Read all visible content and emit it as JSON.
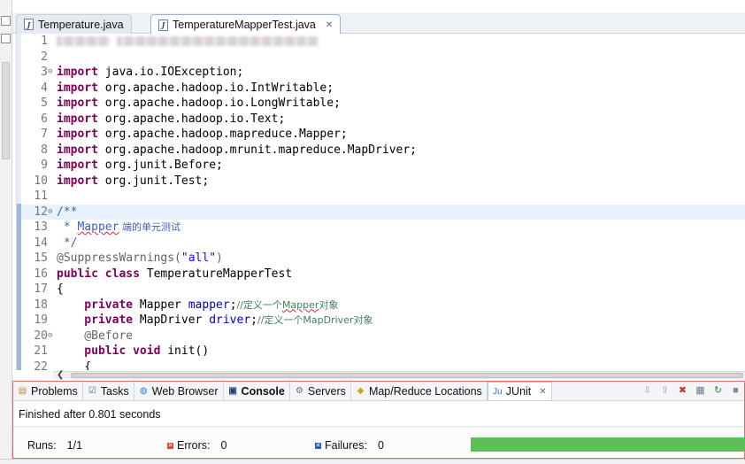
{
  "editor_tabs": [
    {
      "label": "Temperature.java",
      "active": false
    },
    {
      "label": "TemperatureMapperTest.java",
      "active": true,
      "close": "✕"
    }
  ],
  "code_lines": [
    {
      "n": "1"
    },
    {
      "n": "2"
    },
    {
      "n": "3",
      "fold": "⊖",
      "kw": "import",
      "rest": " java.io.IOException;"
    },
    {
      "n": "4",
      "kw": "import",
      "rest": " org.apache.hadoop.io.IntWritable;"
    },
    {
      "n": "5",
      "kw": "import",
      "rest": " org.apache.hadoop.io.LongWritable;"
    },
    {
      "n": "6",
      "kw": "import",
      "rest": " org.apache.hadoop.io.Text;"
    },
    {
      "n": "7",
      "kw": "import",
      "rest": " org.apache.hadoop.mapreduce.Mapper;"
    },
    {
      "n": "8",
      "kw": "import",
      "rest": " org.apache.hadoop.mrunit.mapreduce.MapDriver;"
    },
    {
      "n": "9",
      "kw": "import",
      "rest": " org.junit.Before;"
    },
    {
      "n": "10",
      "kw": "import",
      "rest": " org.junit.Test;"
    },
    {
      "n": "11"
    },
    {
      "n": "12",
      "fold": "⊖",
      "doc": "/**"
    },
    {
      "n": "13",
      "doc_prefix": " * ",
      "doc_word": "Mapper",
      "doc_cjk": " 端的单元测试"
    },
    {
      "n": "14",
      "doc": " */"
    },
    {
      "n": "15",
      "ann": "@SuppressWarnings(",
      "str": "\"all\"",
      "ann_end": ")"
    },
    {
      "n": "16",
      "kw": "public class",
      "rest": " TemperatureMapperTest"
    },
    {
      "n": "17",
      "rest": "{"
    },
    {
      "n": "18",
      "kw": "    private",
      "type": " Mapper ",
      "field": "mapper",
      "semi": ";",
      "cmt": "//定义一个",
      "cmt_word": "Mapper",
      "cmt_end": "对象"
    },
    {
      "n": "19",
      "kw": "    private",
      "type": " MapDriver ",
      "field": "driver",
      "semi": ";",
      "cmt": "//定义一个MapDriver对象"
    },
    {
      "n": "20",
      "fold": "⊖",
      "ann": "    @Before"
    },
    {
      "n": "21",
      "kw": "    public void",
      "rest": " init()"
    },
    {
      "n": "22",
      "rest": "    {"
    }
  ],
  "views": {
    "tabs": [
      {
        "label": "Problems",
        "icon": "problems-icon",
        "glyph": "▤"
      },
      {
        "label": "Tasks",
        "icon": "tasks-icon",
        "glyph": "☑"
      },
      {
        "label": "Web Browser",
        "icon": "globe-icon",
        "glyph": "◍"
      },
      {
        "label": "Console",
        "icon": "console-icon",
        "glyph": "▣",
        "bold": true
      },
      {
        "label": "Servers",
        "icon": "servers-icon",
        "glyph": "⚙"
      },
      {
        "label": "Map/Reduce Locations",
        "icon": "elephant-icon",
        "glyph": "◆"
      },
      {
        "label": "JUnit",
        "icon": "junit-icon",
        "glyph": "Ju",
        "active": true,
        "close": "✕"
      }
    ],
    "tools": [
      {
        "name": "next-failure-icon",
        "glyph": "⇩"
      },
      {
        "name": "prev-failure-icon",
        "glyph": "⇧"
      },
      {
        "name": "show-failures-only-icon",
        "glyph": "✖"
      },
      {
        "name": "scroll-lock-icon",
        "glyph": "▦"
      },
      {
        "name": "rerun-test-icon",
        "glyph": "↻"
      },
      {
        "name": "stop-icon",
        "glyph": "■"
      }
    ]
  },
  "junit": {
    "finished": "Finished after 0.801 seconds",
    "runs_label": "Runs:",
    "runs_value": "1/1",
    "errors_label": "Errors:",
    "errors_value": "0",
    "failures_label": "Failures:",
    "failures_value": "0",
    "progress": 1.0,
    "progress_color": "#5cbf58"
  },
  "colors": {
    "keyword": "#7f0055",
    "string": "#2a00ff",
    "javadoc": "#3f5fbf",
    "comment": "#3f7f5f",
    "field": "#0000c0",
    "annotation": "#646464"
  }
}
